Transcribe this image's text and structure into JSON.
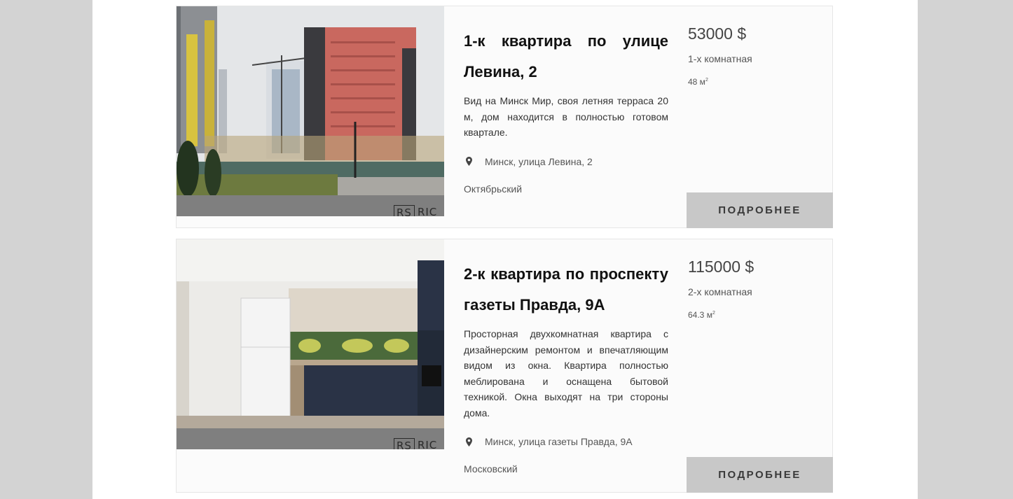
{
  "listings": [
    {
      "title": "1-к квартира по улице Левина, 2",
      "description": "Вид на Минск Мир, своя летняя терраса 20 м, дом находится в полностью готовом квартале.",
      "address": "Минск, улица Левина, 2",
      "district": "Октябрьский",
      "price": "53000 $",
      "rooms": "1-х комнатная",
      "area": "48 м",
      "area_unit_sup": "2",
      "button_label": "ПОДРОБНЕЕ",
      "watermark": {
        "box": "RS",
        "text": "RIC"
      },
      "photo_icon": "building-exterior-photo"
    },
    {
      "title": "2-к квартира по проспекту газеты Правда, 9А",
      "description": "Просторная двухкомнатная квартира с дизайнерским ремонтом и впечатляющим видом из окна. Квартира полностью меблирована и оснащена бытовой техникой. Окна выходят на три стороны дома.",
      "address": "Минск, улица газеты Правда, 9А",
      "district": "Московский",
      "price": "115000 $",
      "rooms": "2-х комнатная",
      "area": "64.3 м",
      "area_unit_sup": "2",
      "button_label": "ПОДРОБНЕЕ",
      "watermark": {
        "box": "RS",
        "text": "RIC"
      },
      "photo_icon": "kitchen-interior-photo"
    }
  ],
  "colors": {
    "page_bg": "#d3d3d3",
    "content_bg": "#ffffff",
    "card_bg": "#fbfbfb",
    "button_bg": "#c8c8c8",
    "button_text": "#3a3a3a"
  }
}
